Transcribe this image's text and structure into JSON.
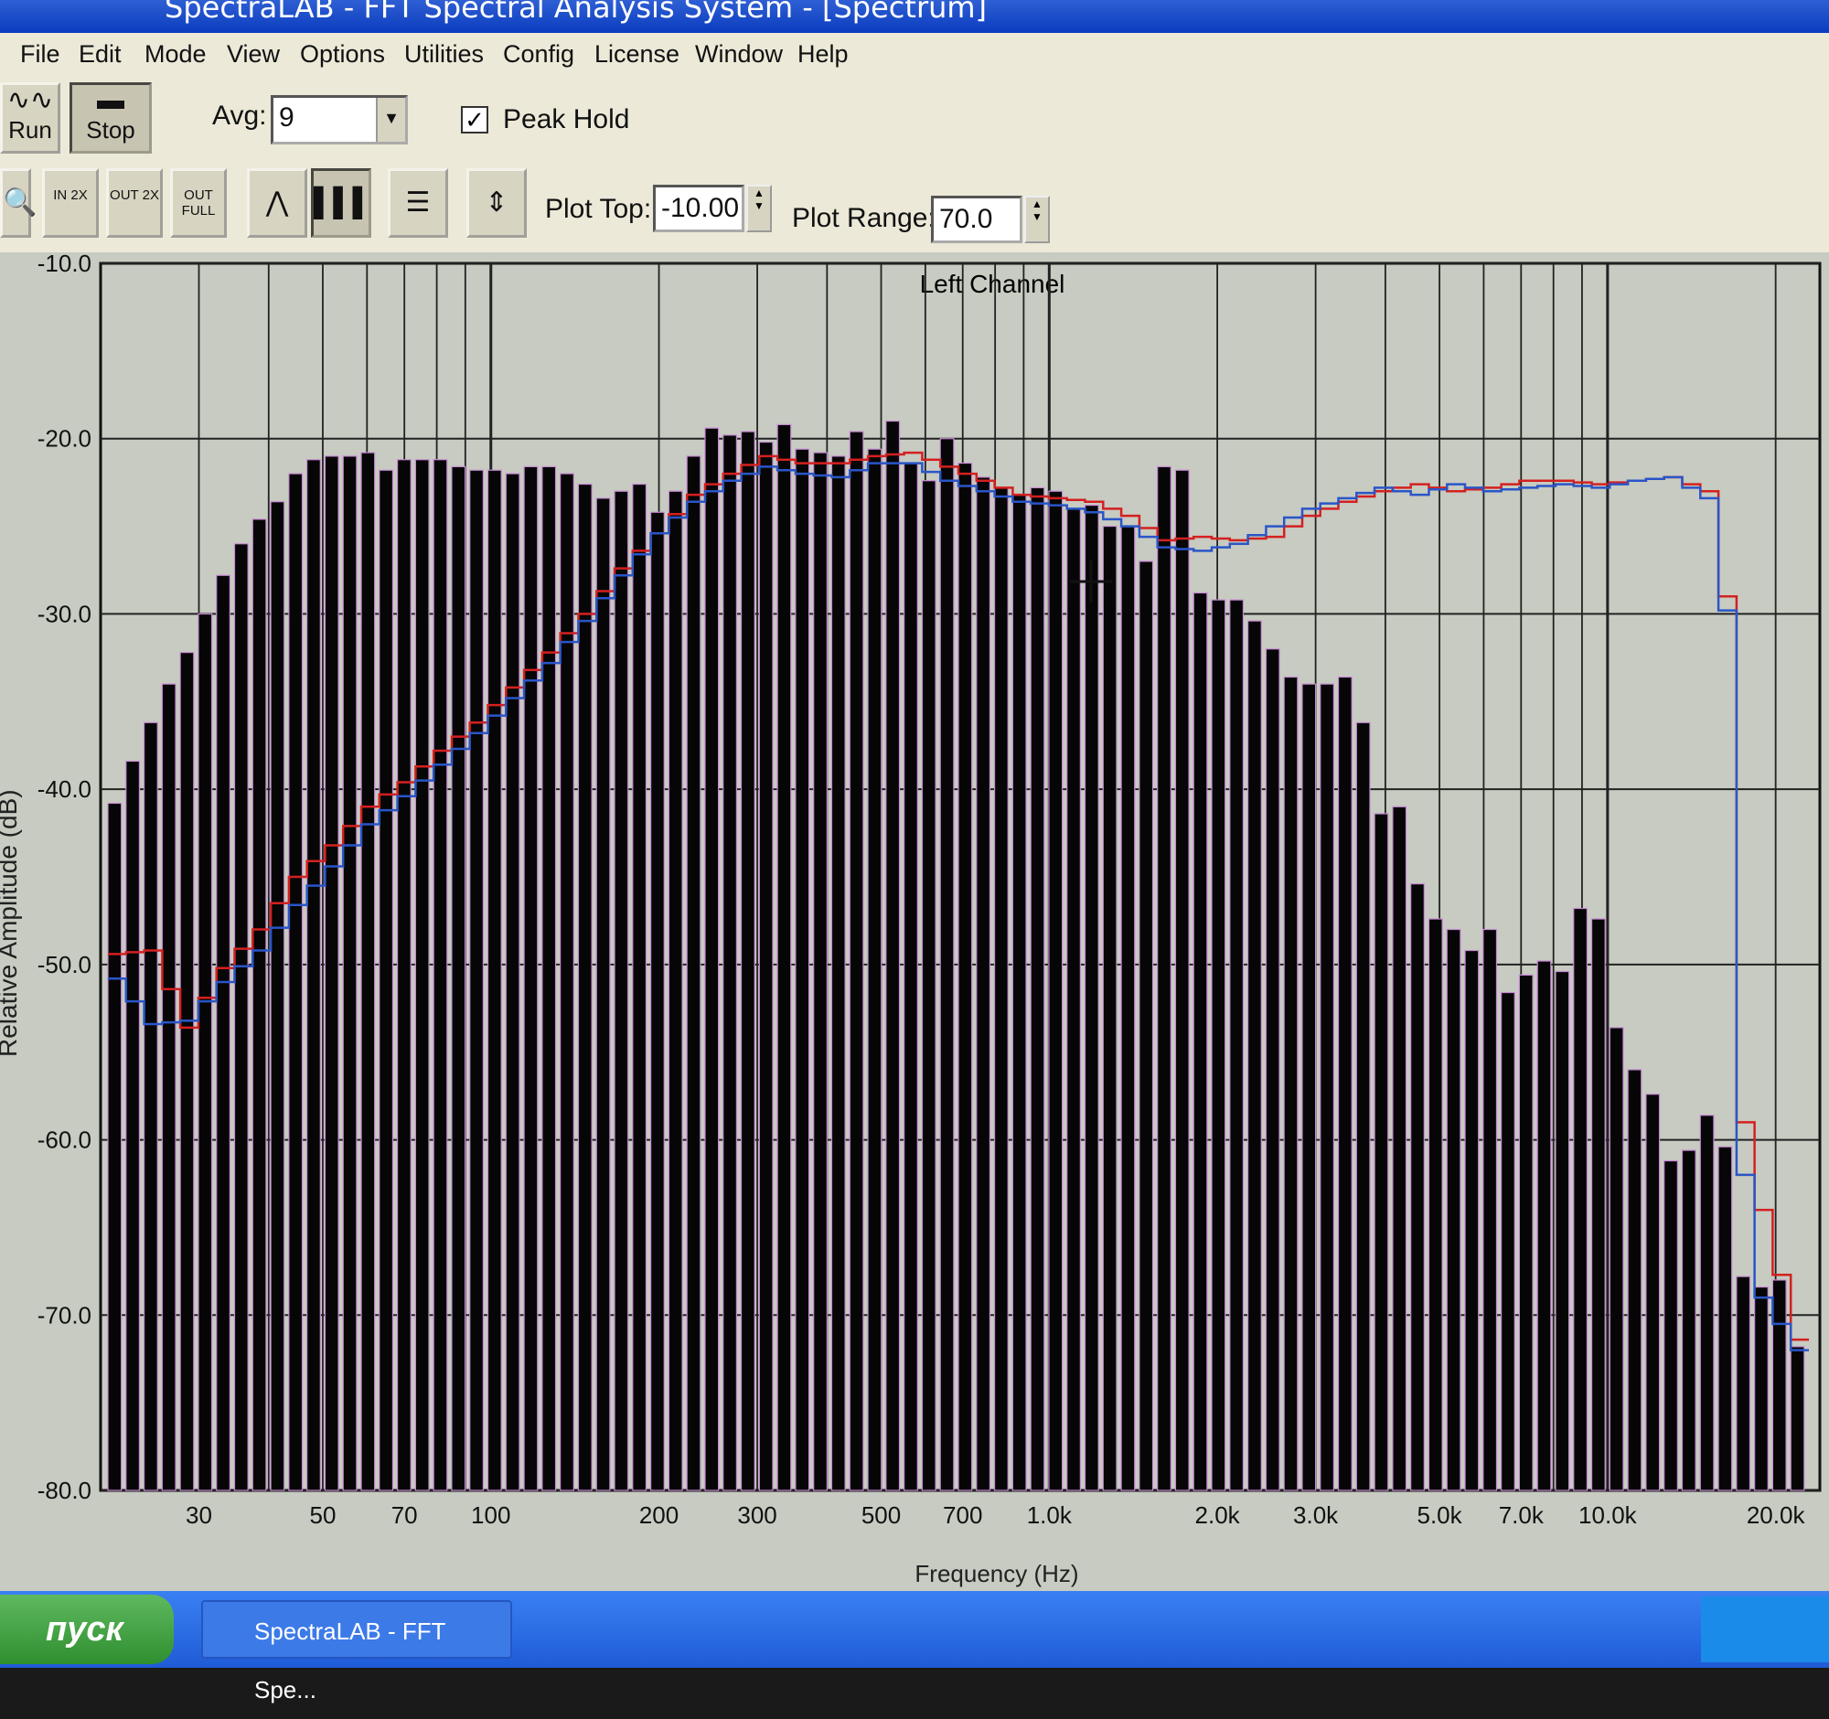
{
  "window": {
    "title": "SpectraLAB - FFT Spectral Analysis System - [Spectrum]"
  },
  "menu": [
    "File",
    "Edit",
    "Mode",
    "View",
    "Options",
    "Utilities",
    "Config",
    "License",
    "Window",
    "Help"
  ],
  "toolbar": {
    "run_label": "Run",
    "stop_label": "Stop",
    "avg_label": "Avg:",
    "avg_value": "9",
    "peak_hold_label": "Peak Hold",
    "peak_hold_checked": true,
    "zoom_in_label": "IN 2X",
    "zoom_out_label": "OUT 2X",
    "zoom_full_label": "OUT FULL",
    "plot_top_label": "Plot Top:",
    "plot_top_value": "-10.00",
    "plot_range_label": "Plot Range:",
    "plot_range_value": "70.0"
  },
  "chart_data": {
    "type": "bar",
    "title": "Left Channel",
    "xlabel": "Frequency (Hz)",
    "ylabel": "Relative Amplitude (dB)",
    "x_scale": "log",
    "xlim": [
      20,
      24000
    ],
    "ylim": [
      -80,
      -10
    ],
    "grid": true,
    "yticks": [
      "-10.0",
      "-20.0",
      "-30.0",
      "-40.0",
      "-50.0",
      "-60.0",
      "-70.0",
      "-80.0"
    ],
    "xticks": [
      {
        "f": 30,
        "label": "30"
      },
      {
        "f": 50,
        "label": "50"
      },
      {
        "f": 70,
        "label": "70"
      },
      {
        "f": 100,
        "label": "100"
      },
      {
        "f": 200,
        "label": "200"
      },
      {
        "f": 300,
        "label": "300"
      },
      {
        "f": 500,
        "label": "500"
      },
      {
        "f": 700,
        "label": "700"
      },
      {
        "f": 1000,
        "label": "1.0k"
      },
      {
        "f": 2000,
        "label": "2.0k"
      },
      {
        "f": 3000,
        "label": "3.0k"
      },
      {
        "f": 5000,
        "label": "5.0k"
      },
      {
        "f": 7000,
        "label": "7.0k"
      },
      {
        "f": 10000,
        "label": "10.0k"
      },
      {
        "f": 20000,
        "label": "20.0k"
      }
    ],
    "bars": [
      -40.8,
      -38.4,
      -36.2,
      -34.0,
      -32.2,
      -30.0,
      -27.8,
      -26.0,
      -24.6,
      -23.6,
      -22.0,
      -21.2,
      -21.0,
      -21.0,
      -20.8,
      -21.8,
      -21.2,
      -21.2,
      -21.2,
      -21.6,
      -21.8,
      -21.8,
      -22.0,
      -21.6,
      -21.6,
      -22.0,
      -22.6,
      -23.4,
      -23.0,
      -22.6,
      -24.2,
      -23.0,
      -21.0,
      -19.4,
      -19.8,
      -19.6,
      -20.2,
      -19.2,
      -20.6,
      -20.8,
      -21.0,
      -19.6,
      -20.6,
      -19.0,
      -21.4,
      -22.4,
      -20.0,
      -21.4,
      -22.2,
      -22.8,
      -23.2,
      -22.8,
      -23.0,
      -24.0,
      -23.8,
      -25.0,
      -25.0,
      -27.0,
      -21.6,
      -21.8,
      -28.8,
      -29.2,
      -29.2,
      -30.4,
      -32.0,
      -33.6,
      -34.0,
      -34.0,
      -33.6,
      -36.2,
      -41.4,
      -41.0,
      -45.4,
      -47.4,
      -48.0,
      -49.2,
      -48.0,
      -51.6,
      -50.6,
      -49.8,
      -50.4,
      -46.8,
      -47.4,
      -53.6,
      -56.0,
      -57.4,
      -61.2,
      -60.6,
      -58.6,
      -60.4,
      -67.8,
      -68.4,
      -68.0,
      -71.8
    ]
  }
}
